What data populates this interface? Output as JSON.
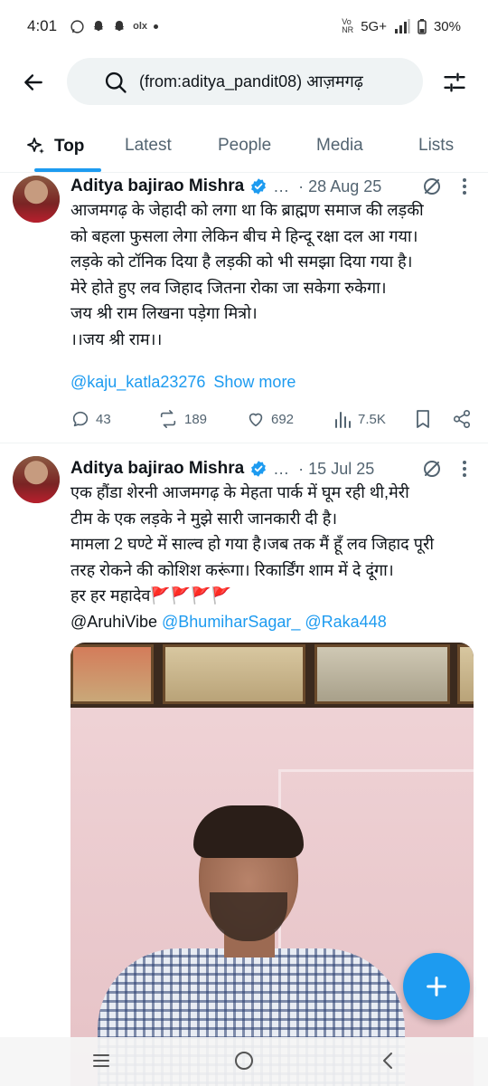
{
  "status_bar": {
    "time": "4:01",
    "notification_icons": [
      "whatsapp-icon",
      "snapchat-icon",
      "snapchat-icon",
      "olx-icon",
      "dot"
    ],
    "network_tag": "Vo\nNR",
    "network": "5G+",
    "battery": "30%"
  },
  "search": {
    "query": "(from:aditya_pandit08) आज़मगढ़"
  },
  "tabs": [
    {
      "label": "Top",
      "active": true
    },
    {
      "label": "Latest",
      "active": false
    },
    {
      "label": "People",
      "active": false
    },
    {
      "label": "Media",
      "active": false
    },
    {
      "label": "Lists",
      "active": false
    }
  ],
  "tweets": [
    {
      "author": "Aditya bajirao Mishra",
      "name_ellipsis": "…",
      "date": "· 28 Aug 25",
      "lines": [
        "आजमगढ़ के जेहादी को लगा था कि ब्राह्मण समाज की लड़की",
        "को बहला फुसला लेगा लेकिन बीच मे हिन्दू रक्षा दल आ गया।",
        "लड़के को टॉनिक दिया है लड़की को भी समझा दिया गया है।",
        "मेरे होते हुए लव जिहाद जितना रोका जा सकेगा रुकेगा।",
        "जय श्री राम लिखना पड़ेगा मित्रो।",
        "।।जय श्री राम।।"
      ],
      "mention": "@kaju_katla23276",
      "show_more": "Show more",
      "replies": "43",
      "reposts": "189",
      "likes": "692",
      "views": "7.5K"
    },
    {
      "author": "Aditya bajirao Mishra",
      "name_ellipsis": "…",
      "date": "· 15 Jul 25",
      "lines": [
        "एक हौंडा शेरनी आजमगढ़ के मेहता पार्क में घूम रही थी,मेरी",
        "टीम के एक लड़के ने मुझे सारी जानकारी दी है।",
        "मामला 2 घण्टे में साल्व हो गया है।जब तक मैं हूँ लव जिहाद पूरी",
        "तरह रोकने की कोशिश करूंगा। रिकार्डिंग शाम में दे दूंगा।",
        "हर हर महादेव🚩🚩🚩🚩"
      ],
      "mention_plain": "@AruhiVibe",
      "mention_link_1": "@BhumiharSagar_",
      "mention_link_2": "@Raka448"
    }
  ],
  "colors": {
    "accent": "#1d9bf0",
    "text": "#0f1419",
    "secondary": "#536471"
  }
}
